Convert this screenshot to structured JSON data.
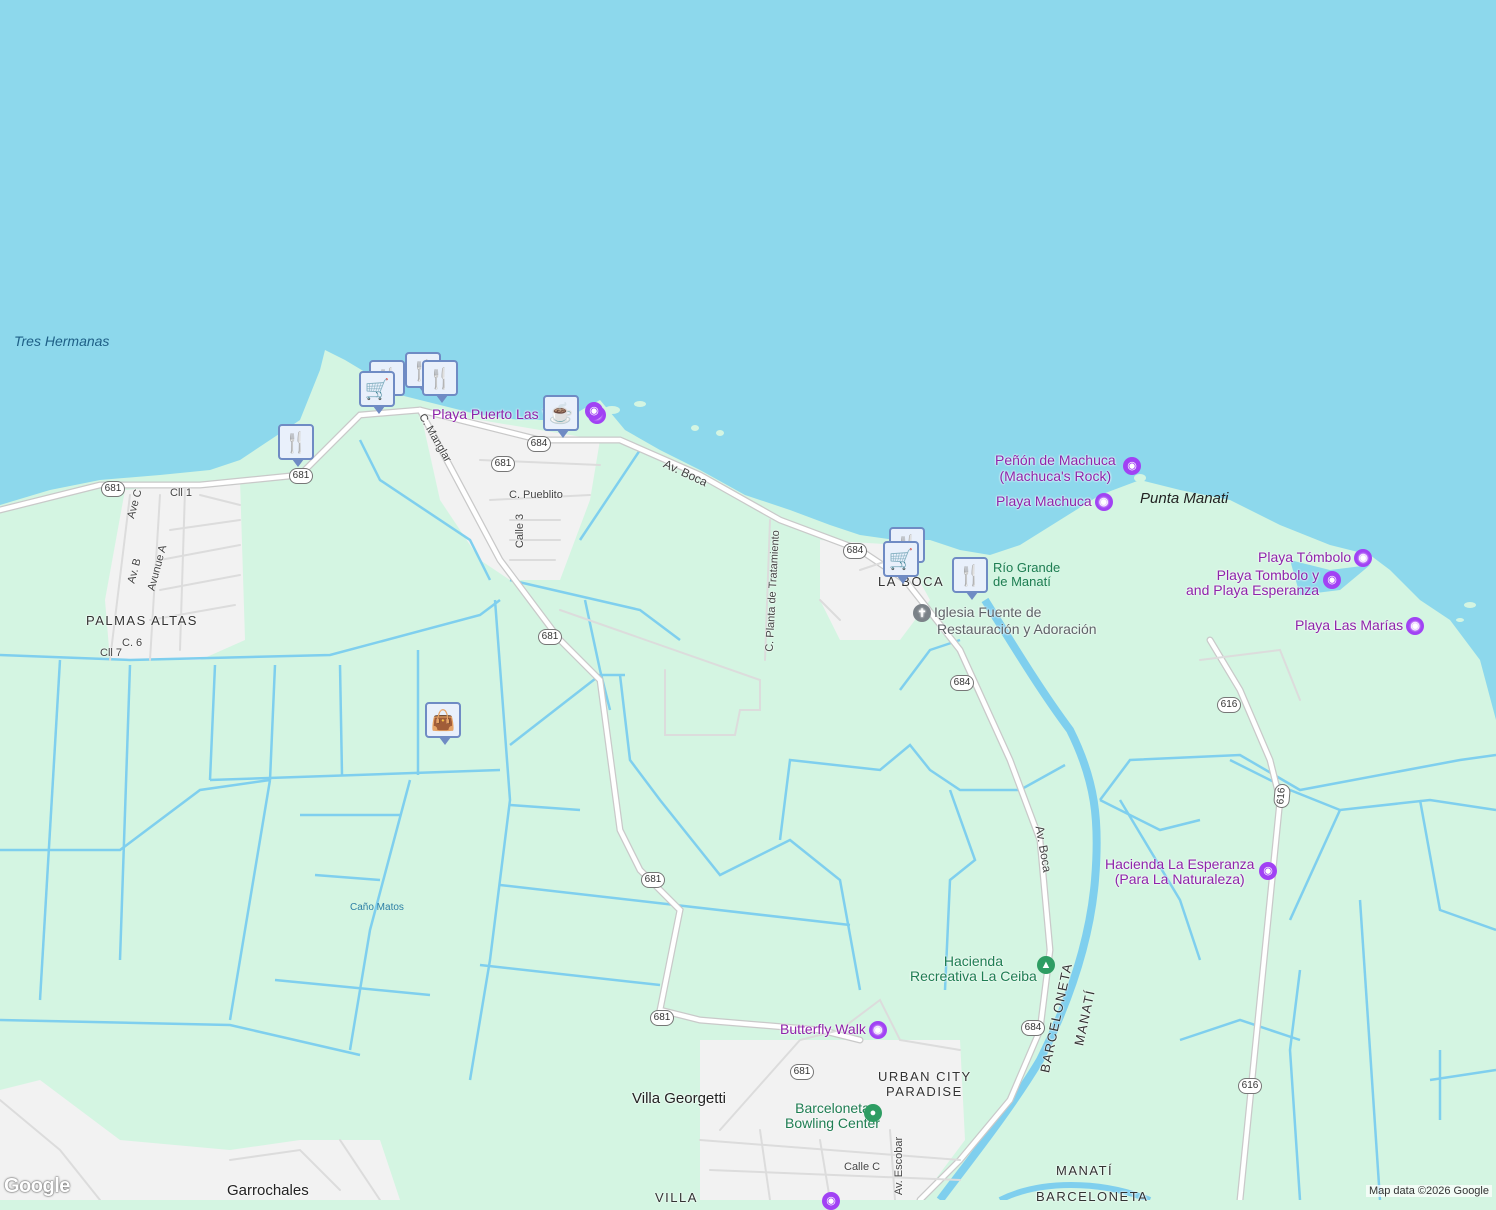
{
  "map": {
    "colors": {
      "water": "#8dd8ec",
      "land": "#d4f5e2",
      "road": "#ffffff",
      "road_outline": "#c9c9c9",
      "canal": "#7fcfee",
      "urban": "#f0f0f0",
      "poi_purple": "#8e24aa"
    },
    "labels": {
      "tres_hermanas": "Tres Hermanas",
      "punta_manati": "Punta Manati",
      "palmas_altas": "PALMAS ALTAS",
      "la_boca": "LA BOCA",
      "urban_city_paradise_1": "URBAN CITY",
      "urban_city_paradise_2": "PARADISE",
      "villa_georgetti": "Villa Georgetti",
      "garrochales": "Garrochales",
      "villa_partial": "VILLA",
      "manati_bottom": "MANATÍ",
      "barceloneta_bottom": "BARCELONETA",
      "barceloneta_river_1": "BARCELONETA",
      "barceloneta_river_2": "MANATÍ",
      "cano_matos": "Caño Matos",
      "rio_grande_1": "Río Grande",
      "rio_grande_2": "de Manatí"
    },
    "pois": {
      "playa_puerto_las": "Playa Puerto Las V",
      "penon_1": "Peñón de Machuca",
      "penon_2": "(Machuca's Rock)",
      "playa_machuca": "Playa Machuca",
      "playa_tombolo": "Playa Tómbolo",
      "playa_tombolo_y_1": "Playa Tombolo y",
      "playa_tombolo_y_2": "and Playa Esperanza",
      "playa_las_marias": "Playa Las Marías",
      "iglesia_1": "Iglesia Fuente de",
      "iglesia_2": "Restauración y Adoración",
      "hacienda_esperanza_1": "Hacienda La Esperanza",
      "hacienda_esperanza_2": "(Para La Naturaleza)",
      "hacienda_ceiba_1": "Hacienda",
      "hacienda_ceiba_2": "Recreativa La Ceiba",
      "butterfly_walk": "Butterfly Walk",
      "bowling_1": "Barceloneta",
      "bowling_2": "Bowling Center"
    },
    "streets": {
      "av_boca_1": "Av. Boca",
      "av_boca_2": "Av. Boca",
      "c_manglar": "C. Manglar",
      "c_pueblito": "C. Pueblito",
      "calle_3": "Calle 3",
      "c_planta": "C. Planta de Tratamiento",
      "ave_c": "Ave C",
      "cll_1": "Cll 1",
      "av_b": "Av. B",
      "avunue_a": "Avunue A",
      "c_6": "C. 6",
      "cll_7": "Cll 7",
      "calle_c": "Calle C",
      "av_escobar": "Av. Escobar"
    },
    "shields": {
      "r681_a": "681",
      "r681_b": "681",
      "r681_c": "681",
      "r681_d": "681",
      "r681_e": "681",
      "r681_f": "681",
      "r684_a": "684",
      "r684_b": "684",
      "r684_c": "684",
      "r684_d": "684",
      "r616_a": "616",
      "r616_b": "616",
      "r616_c": "616"
    },
    "markers": [
      "restaurant",
      "restaurant",
      "restaurant",
      "shopping-cart",
      "restaurant",
      "coffee",
      "restaurant",
      "shopping-cart",
      "restaurant",
      "shopping-bag"
    ],
    "attribution": "Map data ©2026 Google",
    "logo": "Google"
  }
}
